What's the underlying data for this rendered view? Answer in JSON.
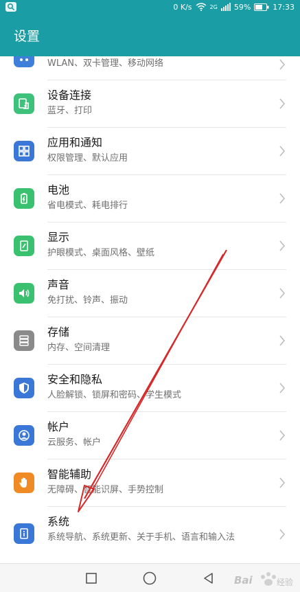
{
  "status_bar": {
    "network_speed": "0 K/s",
    "signal_label": "2G",
    "battery": "59%",
    "time": "17:33"
  },
  "app_bar": {
    "title": "设置"
  },
  "settings": [
    {
      "title": "",
      "subtitle": "WLAN、双卡管理、移动网络",
      "icon": "network-icon",
      "color": "#3f7fdc"
    },
    {
      "title": "设备连接",
      "subtitle": "蓝牙、打印",
      "icon": "device-connection-icon",
      "color": "#3ec27b"
    },
    {
      "title": "应用和通知",
      "subtitle": "权限管理、默认应用",
      "icon": "apps-icon",
      "color": "#3a77d6"
    },
    {
      "title": "电池",
      "subtitle": "省电模式、耗电排行",
      "icon": "battery-icon",
      "color": "#39c16f"
    },
    {
      "title": "显示",
      "subtitle": "护眼模式、桌面风格、壁纸",
      "icon": "display-icon",
      "color": "#39c16f"
    },
    {
      "title": "声音",
      "subtitle": "免打扰、铃声、振动",
      "icon": "sound-icon",
      "color": "#39c16f"
    },
    {
      "title": "存储",
      "subtitle": "内存、空间清理",
      "icon": "storage-icon",
      "color": "#8a8a8a"
    },
    {
      "title": "安全和隐私",
      "subtitle": "人脸解锁、锁屏和密码、学生模式",
      "icon": "shield-icon",
      "color": "#3a77d6"
    },
    {
      "title": "帐户",
      "subtitle": "云服务、帐户",
      "icon": "account-icon",
      "color": "#3a77d6"
    },
    {
      "title": "智能辅助",
      "subtitle": "无障碍、智能识屏、手势控制",
      "icon": "hand-icon",
      "color": "#f08a24"
    },
    {
      "title": "系统",
      "subtitle": "系统导航、系统更新、关于手机、语言和输入法",
      "icon": "system-info-icon",
      "color": "#3a77d6"
    }
  ],
  "nav_bar": {
    "recent_icon": "recent-apps-icon",
    "home_icon": "home-icon",
    "back_icon": "back-icon"
  },
  "watermark": {
    "text": "Bai经验"
  },
  "annotation": {
    "color": "#d62a2a"
  }
}
